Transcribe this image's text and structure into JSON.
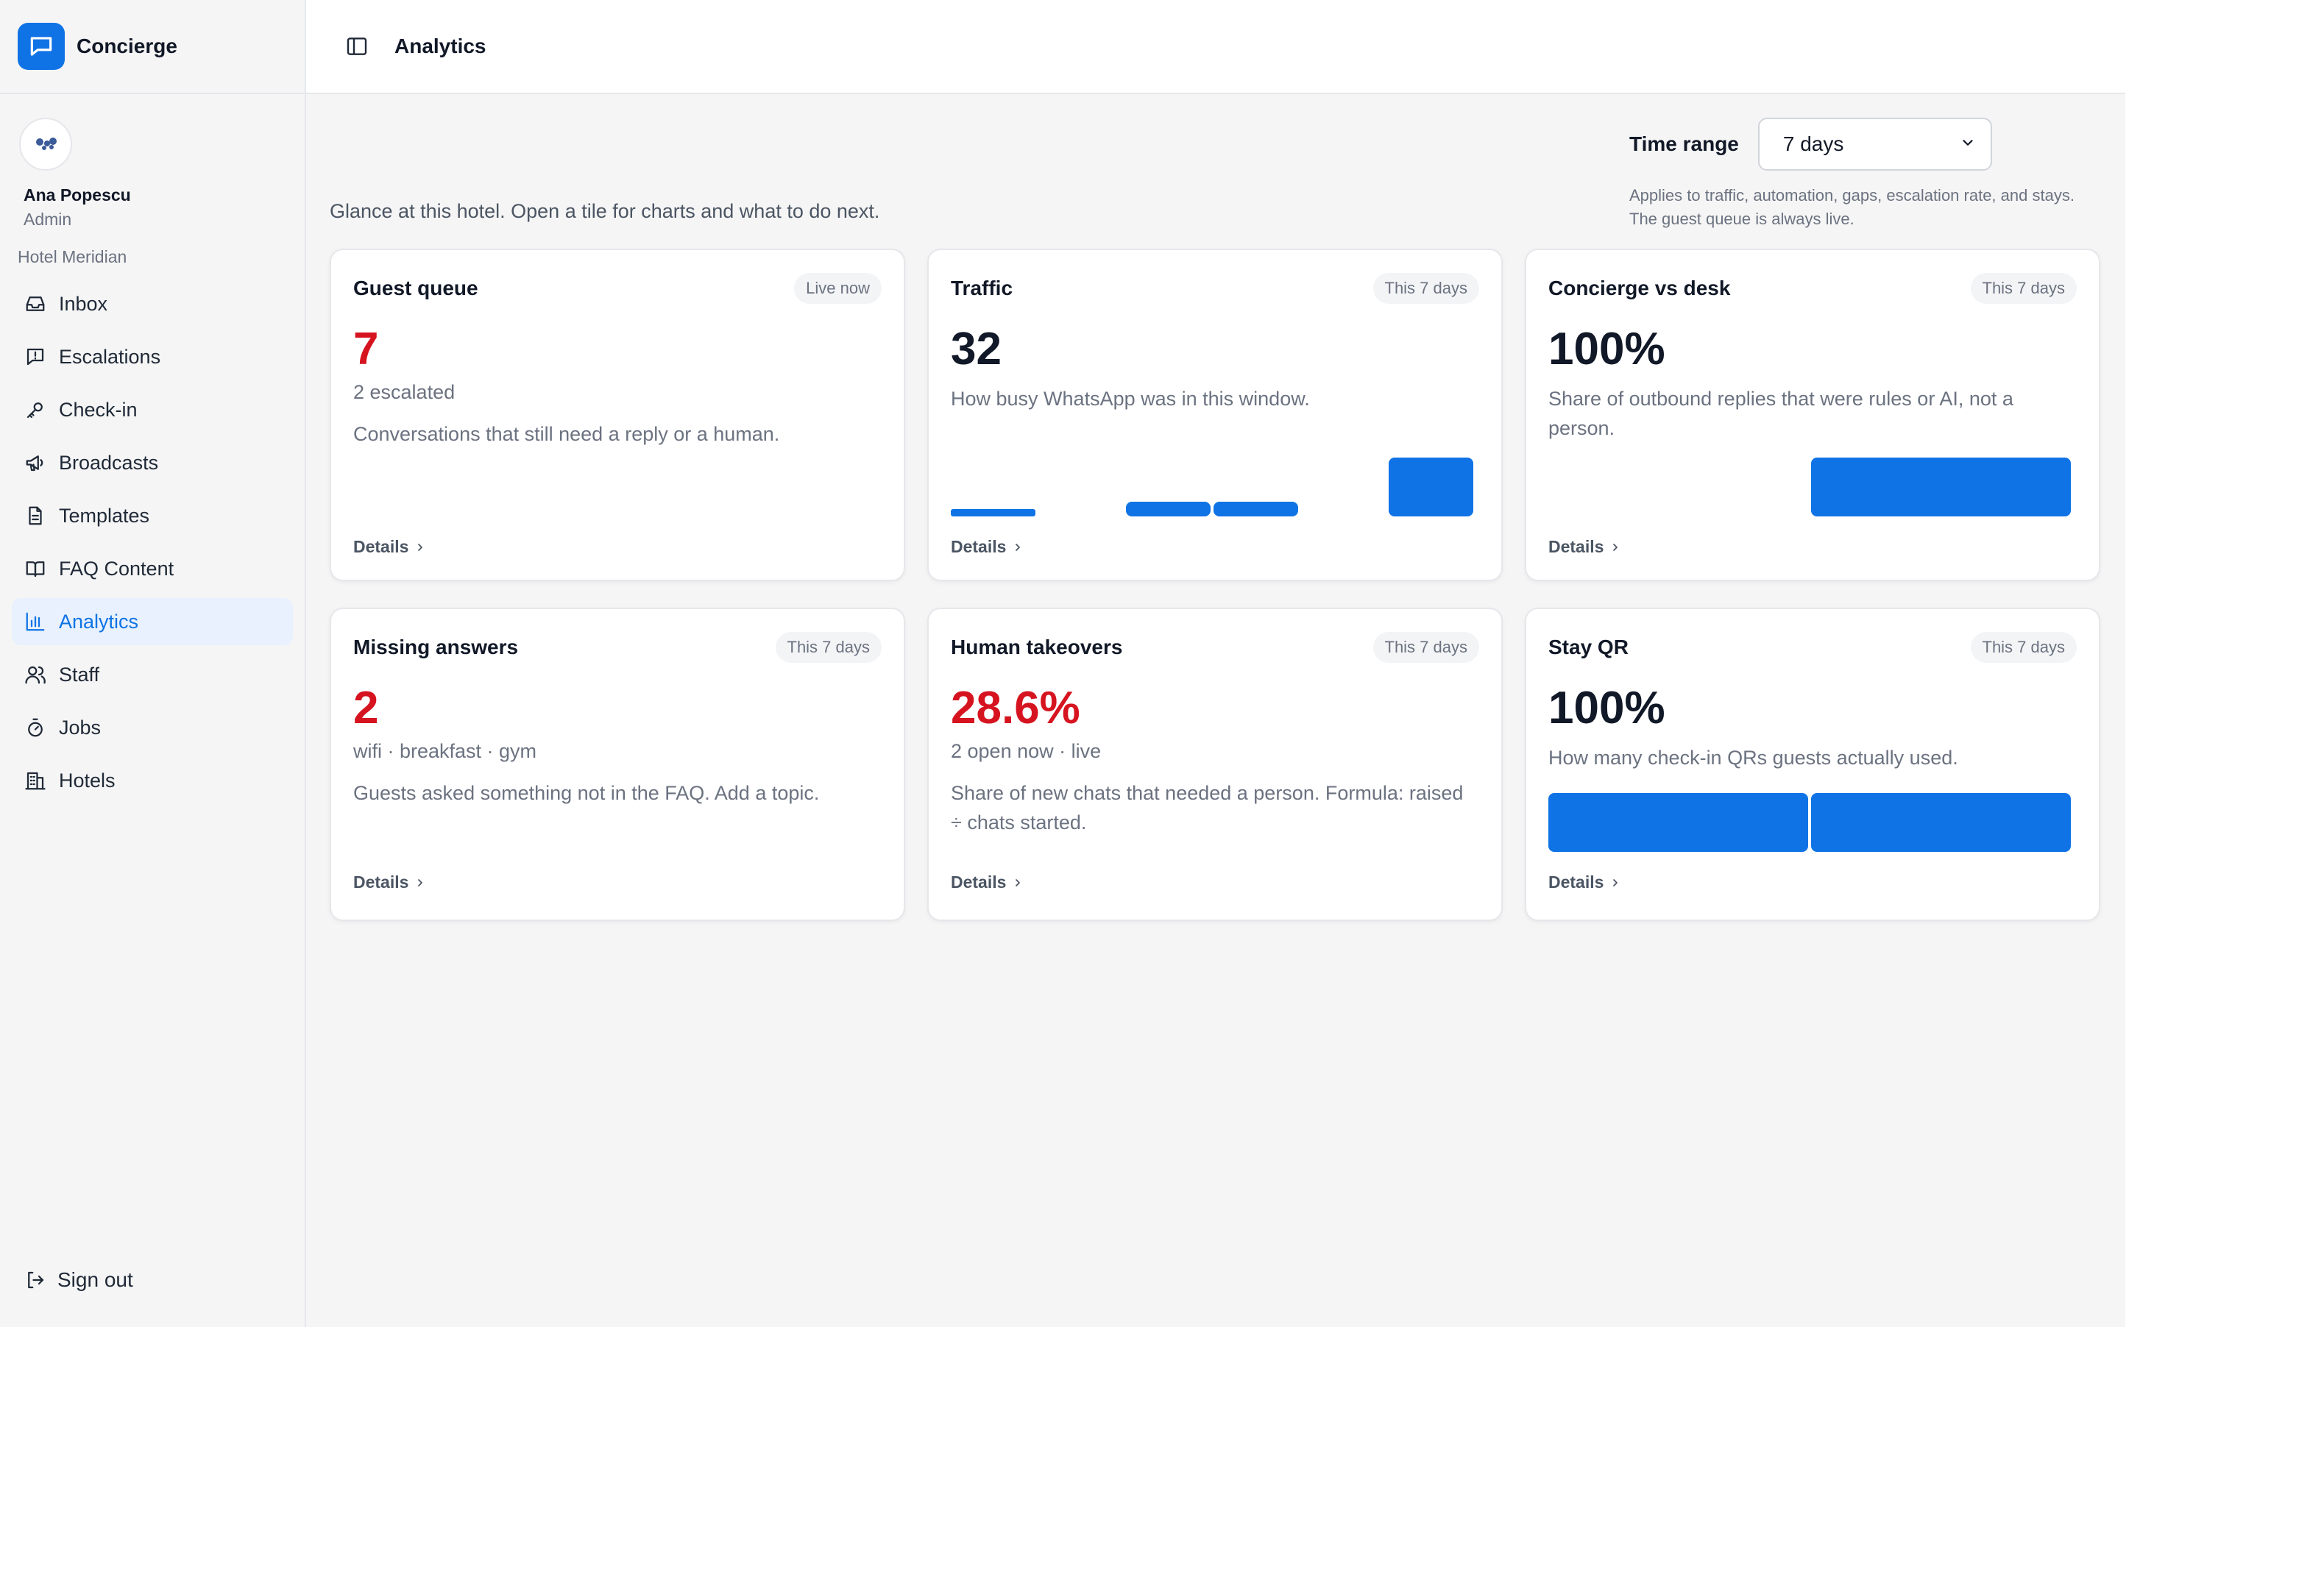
{
  "app": {
    "name": "Concierge",
    "logo_icon": "chat-bubble-icon",
    "accent": "#0f73e6",
    "alert": "#d61420"
  },
  "user": {
    "name": "Ana Popescu",
    "role": "Admin",
    "hotel": "Hotel Meridian"
  },
  "nav": [
    {
      "label": "Inbox",
      "icon": "inbox-icon",
      "active": false
    },
    {
      "label": "Escalations",
      "icon": "message-alert-icon",
      "active": false
    },
    {
      "label": "Check-in",
      "icon": "key-icon",
      "active": false
    },
    {
      "label": "Broadcasts",
      "icon": "megaphone-icon",
      "active": false
    },
    {
      "label": "Templates",
      "icon": "document-icon",
      "active": false
    },
    {
      "label": "FAQ Content",
      "icon": "book-icon",
      "active": false
    },
    {
      "label": "Analytics",
      "icon": "bar-chart-icon",
      "active": true
    },
    {
      "label": "Staff",
      "icon": "users-icon",
      "active": false
    },
    {
      "label": "Jobs",
      "icon": "timer-icon",
      "active": false
    },
    {
      "label": "Hotels",
      "icon": "building-icon",
      "active": false
    }
  ],
  "signout": {
    "label": "Sign out",
    "icon": "sign-out-icon"
  },
  "header": {
    "title": "Analytics",
    "toggle_icon": "sidebar-toggle-icon"
  },
  "time_range": {
    "label": "Time range",
    "selected": "7 days",
    "help": "Applies to traffic, automation, gaps, escalation rate, and stays. The guest queue is always live."
  },
  "intro": "Glance at this hotel. Open a tile for charts and what to do next.",
  "cards": {
    "guest_queue": {
      "title": "Guest queue",
      "badge": "Live now",
      "metric": "7",
      "sub": "2 escalated",
      "desc": "Conversations that still need a reply or a human.",
      "details": "Details"
    },
    "traffic": {
      "title": "Traffic",
      "badge": "This 7 days",
      "metric": "32",
      "desc": "How busy WhatsApp was in this window.",
      "details": "Details"
    },
    "concierge_vs_desk": {
      "title": "Concierge vs desk",
      "badge": "This 7 days",
      "metric": "100%",
      "desc": "Share of outbound replies that were rules or AI, not a person.",
      "details": "Details"
    },
    "missing_answers": {
      "title": "Missing answers",
      "badge": "This 7 days",
      "metric": "2",
      "sub": "wifi · breakfast · gym",
      "desc": "Guests asked something not in the FAQ. Add a topic.",
      "details": "Details"
    },
    "human_takeovers": {
      "title": "Human takeovers",
      "badge": "This 7 days",
      "metric": "28.6%",
      "sub": "2 open now · live",
      "desc": "Share of new chats that needed a person. Formula: raised ÷ chats started.",
      "details": "Details"
    },
    "stay_qr": {
      "title": "Stay QR",
      "badge": "This 7 days",
      "metric": "100%",
      "desc": "How many check-in QRs guests actually used.",
      "details": "Details"
    }
  },
  "chart_data": [
    {
      "type": "bar",
      "title": "",
      "series": [
        {
          "values": [
            1,
            0,
            2,
            2,
            0,
            8
          ]
        }
      ]
    },
    {
      "type": "bar",
      "title": "",
      "series": [
        {
          "values": [
            0,
            100
          ]
        }
      ]
    },
    {
      "type": "bar",
      "title": "",
      "series": [
        {
          "values": [
            100,
            100
          ]
        }
      ]
    }
  ]
}
